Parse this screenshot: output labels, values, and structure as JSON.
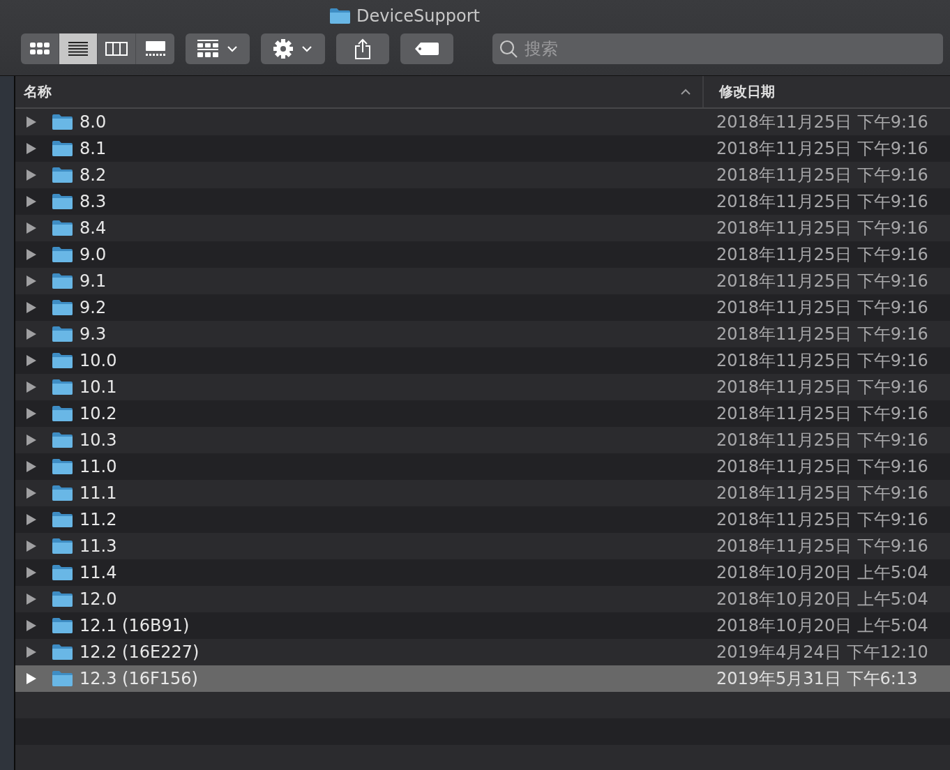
{
  "window": {
    "title": "DeviceSupport"
  },
  "toolbar": {
    "view_modes": [
      {
        "kind": "icons",
        "selected": false
      },
      {
        "kind": "list",
        "selected": true
      },
      {
        "kind": "columns",
        "selected": false
      },
      {
        "kind": "gallery",
        "selected": false
      }
    ],
    "search": {
      "placeholder": "搜索"
    }
  },
  "table": {
    "columns": [
      {
        "label": "名称",
        "sorted": true
      },
      {
        "label": "修改日期",
        "sorted": false
      }
    ],
    "rows": [
      {
        "name": "8.0",
        "date": "2018年11月25日 下午9:16",
        "selected": false
      },
      {
        "name": "8.1",
        "date": "2018年11月25日 下午9:16",
        "selected": false
      },
      {
        "name": "8.2",
        "date": "2018年11月25日 下午9:16",
        "selected": false
      },
      {
        "name": "8.3",
        "date": "2018年11月25日 下午9:16",
        "selected": false
      },
      {
        "name": "8.4",
        "date": "2018年11月25日 下午9:16",
        "selected": false
      },
      {
        "name": "9.0",
        "date": "2018年11月25日 下午9:16",
        "selected": false
      },
      {
        "name": "9.1",
        "date": "2018年11月25日 下午9:16",
        "selected": false
      },
      {
        "name": "9.2",
        "date": "2018年11月25日 下午9:16",
        "selected": false
      },
      {
        "name": "9.3",
        "date": "2018年11月25日 下午9:16",
        "selected": false
      },
      {
        "name": "10.0",
        "date": "2018年11月25日 下午9:16",
        "selected": false
      },
      {
        "name": "10.1",
        "date": "2018年11月25日 下午9:16",
        "selected": false
      },
      {
        "name": "10.2",
        "date": "2018年11月25日 下午9:16",
        "selected": false
      },
      {
        "name": "10.3",
        "date": "2018年11月25日 下午9:16",
        "selected": false
      },
      {
        "name": "11.0",
        "date": "2018年11月25日 下午9:16",
        "selected": false
      },
      {
        "name": "11.1",
        "date": "2018年11月25日 下午9:16",
        "selected": false
      },
      {
        "name": "11.2",
        "date": "2018年11月25日 下午9:16",
        "selected": false
      },
      {
        "name": "11.3",
        "date": "2018年11月25日 下午9:16",
        "selected": false
      },
      {
        "name": "11.4",
        "date": "2018年10月20日 上午5:04",
        "selected": false
      },
      {
        "name": "12.0",
        "date": "2018年10月20日 上午5:04",
        "selected": false
      },
      {
        "name": "12.1 (16B91)",
        "date": "2018年10月20日 上午5:04",
        "selected": false
      },
      {
        "name": "12.2 (16E227)",
        "date": "2019年4月24日 下午12:10",
        "selected": false
      },
      {
        "name": "12.3 (16F156)",
        "date": "2019年5月31日 下午6:13",
        "selected": true
      }
    ]
  }
}
